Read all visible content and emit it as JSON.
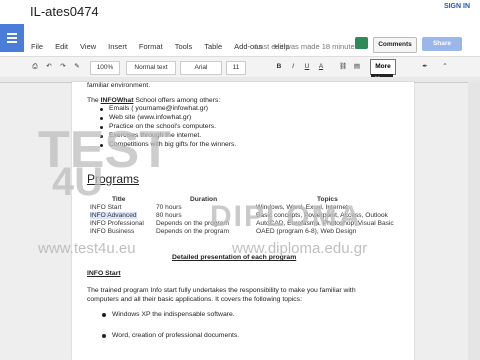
{
  "doc_title": "IL-ates0474",
  "account": {
    "signin": "SIGN IN",
    "sub": "Share"
  },
  "menu": [
    "File",
    "Edit",
    "View",
    "Insert",
    "Format",
    "Tools",
    "Table",
    "Add-ons",
    "Help"
  ],
  "last_edit": "Last edit was made 18 minutes a",
  "buttons": {
    "comments": "Comments",
    "share": "Share",
    "more": "More"
  },
  "toolbar": {
    "zoom": "100%",
    "style": "Normal text",
    "font": "Arial",
    "size": "11",
    "bold": "B",
    "italic": "I",
    "underline": "U",
    "textcolor": "A"
  },
  "tooltip": "More",
  "doc": {
    "line0": "familiar environment.",
    "intro_pre": "The ",
    "intro_bold": "INFOWhat",
    "intro_post": " School offers among others:",
    "bullets": [
      "Emails ( yourname@infowhat.gr)",
      "Web site (www.infowhat.gr)",
      "Practice on the school's computers.",
      "Exercises through the internet.",
      "Competitions with big gifts for the winners."
    ],
    "programs_heading": "Programs",
    "table": {
      "headers": [
        "Title",
        "Duration",
        "Topics"
      ],
      "rows": [
        [
          "INFO Start",
          "70 hours",
          "Windows, Word, Excel, Internet"
        ],
        [
          "INFO Advanced",
          "80 hours",
          "Basic concepts, Powerpoint, Access, Outlook"
        ],
        [
          "INFO Professional",
          "Depends on the program",
          "AutoCAD, Eurofasma, Photoshop, Visual Basic"
        ],
        [
          "INFO Business",
          "Depends on the program",
          "OAED (program 6-8), Web Design"
        ]
      ]
    },
    "detailed": "Detailed presentation of each program",
    "info_start": "INFO Start",
    "para": "The trained program Info start fully undertakes the responsibility to make you familiar with computers and all their basic applications. It covers the following topics:",
    "bullet2": [
      "Windows XP the indispensable software.",
      "Word, creation of professional documents."
    ]
  },
  "watermark": {
    "line1": "TEST",
    "line2": "4U",
    "brand": "DIPLOMA",
    "url1": "www.test4u.eu",
    "url2": "www.diploma.edu.gr"
  }
}
